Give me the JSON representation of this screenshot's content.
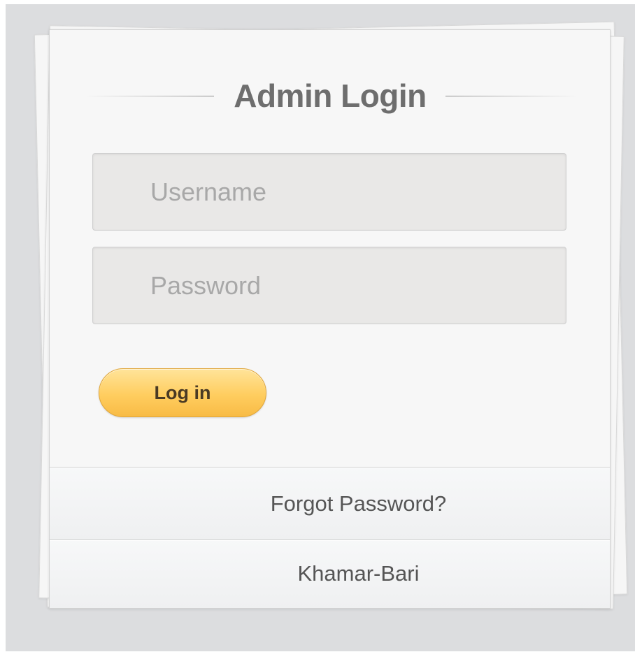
{
  "login": {
    "title": "Admin Login",
    "username_placeholder": "Username",
    "password_placeholder": "Password",
    "submit_label": "Log in",
    "forgot_label": "Forgot Password?",
    "footer_brand": "Khamar-Bari"
  },
  "colors": {
    "button_gradient_top": "#ffe49a",
    "button_gradient_bottom": "#f8bb45",
    "background": "#dcdddf"
  }
}
